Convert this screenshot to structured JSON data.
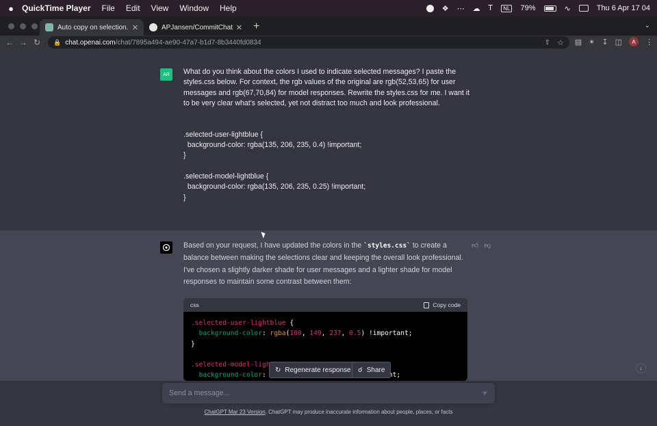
{
  "menubar": {
    "apple": "",
    "app_name": "QuickTime Player",
    "items": [
      "File",
      "Edit",
      "View",
      "Window",
      "Help"
    ],
    "battery": "79%",
    "input_source": "NL",
    "datetime": "Thu 6 Apr  17 04"
  },
  "browser": {
    "tabs": [
      {
        "title": "Auto copy on selection.",
        "icon": "chatgpt-favicon",
        "active": true
      },
      {
        "title": "APJansen/CommitChat: Easily",
        "icon": "github-icon",
        "active": false
      }
    ],
    "url_host": "chat.openai.com",
    "url_path": "/chat/7895a494-ae90-47a7-b1d7-8b3440fd0834",
    "profile_initial": "A"
  },
  "conversation": {
    "user_avatar": "AR",
    "user_message": "What do you think about the colors I used to indicate selected messages? I paste the styles.css below. For context, the rgb values of the original are rgb(52,53,65) for user messages and rgb(67,70,84) for model responses. Rewrite the styles.css for me. I want it to be very clear what's selected, yet not distract too much and look professional.\n\n\n.selected-user-lightblue {\n  background-color: rgba(135, 206, 235, 0.4) !important;\n}\n\n.selected-model-lightblue {\n  background-color: rgba(135, 206, 235, 0.25) !important;\n}",
    "model_text_1": "Based on your request, I have updated the colors in the ",
    "model_code_inline": "`styles.css`",
    "model_text_2": " to create a balance between making the selections clear and keeping the overall look professional. I've chosen a slightly darker shade for user messages and a lighter shade for model responses to maintain some contrast between them:",
    "code_lang": "css",
    "copy_label": "Copy code",
    "code": {
      "sel1": ".selected-user-lightblue",
      "open": " {",
      "prop": "background-color",
      "colon": ": ",
      "fn": "rgba",
      "args1": [
        "100",
        "149",
        "237",
        "0.5"
      ],
      "important": " !important;",
      "close": "}",
      "sel2": ".selected-model-lightb",
      "line5_tail": ") !important;"
    }
  },
  "actions": {
    "regenerate": "Regenerate response",
    "share": "Share"
  },
  "composer": {
    "placeholder": "Send a message..."
  },
  "footer": {
    "link": "ChatGPT Mar 23 Version",
    "text": ". ChatGPT may produce inaccurate information about people, places, or facts"
  }
}
